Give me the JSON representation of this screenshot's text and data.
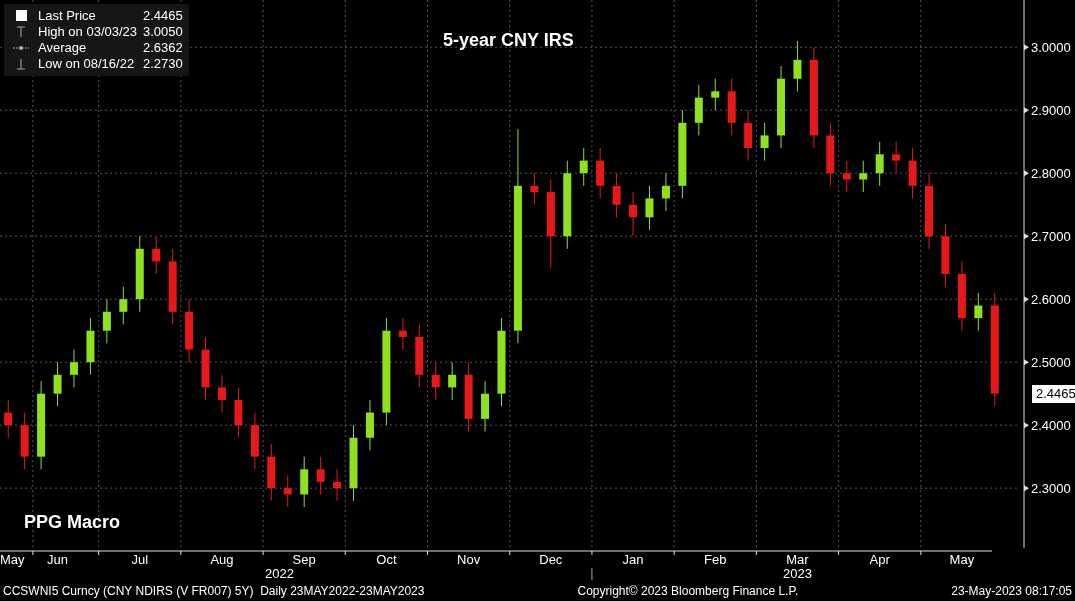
{
  "legend": [
    {
      "kind": "last",
      "label": "Last Price",
      "value": "2.4465"
    },
    {
      "kind": "high",
      "label": "High on 03/03/23",
      "value": "3.0050"
    },
    {
      "kind": "average",
      "label": "Average",
      "value": "2.6362"
    },
    {
      "kind": "low",
      "label": "Low on 08/16/22",
      "value": "2.2730"
    }
  ],
  "title": "5-year CNY IRS",
  "watermark_text": "PPG Macro",
  "last_price_tag": "2.4465",
  "chart_data": {
    "type": "candlestick",
    "grid": true,
    "ylim": [
      2.205,
      3.075
    ],
    "yticks": [
      {
        "value": 2.3,
        "label": "2.3000"
      },
      {
        "value": 2.4,
        "label": "2.4000"
      },
      {
        "value": 2.5,
        "label": "2.5000"
      },
      {
        "value": 2.6,
        "label": "2.6000"
      },
      {
        "value": 2.7,
        "label": "2.7000"
      },
      {
        "value": 2.8,
        "label": "2.8000"
      },
      {
        "value": 2.9,
        "label": "2.9000"
      },
      {
        "value": 3.0,
        "label": "3.0000"
      }
    ],
    "annotations": [
      "2022",
      "2023"
    ],
    "categories": [
      "May",
      null,
      null,
      "Jun",
      null,
      null,
      null,
      null,
      "Jul",
      null,
      null,
      null,
      null,
      "Aug",
      null,
      null,
      null,
      null,
      "Sep",
      null,
      null,
      null,
      null,
      "Oct",
      null,
      null,
      null,
      null,
      "Nov",
      null,
      null,
      null,
      null,
      "Dec",
      null,
      null,
      null,
      null,
      "Jan",
      null,
      null,
      null,
      null,
      "Feb",
      null,
      null,
      null,
      null,
      "Mar",
      null,
      null,
      null,
      null,
      "Apr",
      null,
      null,
      null,
      null,
      "May",
      null,
      null
    ],
    "ohlc": [
      [
        2.42,
        2.44,
        2.38,
        2.4
      ],
      [
        2.4,
        2.42,
        2.33,
        2.35
      ],
      [
        2.35,
        2.47,
        2.33,
        2.45
      ],
      [
        2.45,
        2.5,
        2.43,
        2.48
      ],
      [
        2.48,
        2.52,
        2.46,
        2.5
      ],
      [
        2.5,
        2.57,
        2.48,
        2.55
      ],
      [
        2.55,
        2.6,
        2.53,
        2.58
      ],
      [
        2.58,
        2.62,
        2.56,
        2.6
      ],
      [
        2.6,
        2.7,
        2.58,
        2.68
      ],
      [
        2.68,
        2.7,
        2.64,
        2.66
      ],
      [
        2.66,
        2.68,
        2.56,
        2.58
      ],
      [
        2.58,
        2.6,
        2.5,
        2.52
      ],
      [
        2.52,
        2.54,
        2.44,
        2.46
      ],
      [
        2.46,
        2.48,
        2.42,
        2.44
      ],
      [
        2.44,
        2.46,
        2.38,
        2.4
      ],
      [
        2.4,
        2.42,
        2.33,
        2.35
      ],
      [
        2.35,
        2.37,
        2.28,
        2.3
      ],
      [
        2.3,
        2.32,
        2.27,
        2.29
      ],
      [
        2.29,
        2.35,
        2.27,
        2.33
      ],
      [
        2.33,
        2.35,
        2.29,
        2.31
      ],
      [
        2.31,
        2.33,
        2.28,
        2.3
      ],
      [
        2.3,
        2.4,
        2.28,
        2.38
      ],
      [
        2.38,
        2.44,
        2.36,
        2.42
      ],
      [
        2.42,
        2.57,
        2.4,
        2.55
      ],
      [
        2.55,
        2.57,
        2.52,
        2.54
      ],
      [
        2.54,
        2.56,
        2.46,
        2.48
      ],
      [
        2.48,
        2.5,
        2.44,
        2.46
      ],
      [
        2.46,
        2.5,
        2.44,
        2.48
      ],
      [
        2.48,
        2.5,
        2.39,
        2.41
      ],
      [
        2.41,
        2.47,
        2.39,
        2.45
      ],
      [
        2.45,
        2.57,
        2.43,
        2.55
      ],
      [
        2.55,
        2.87,
        2.53,
        2.78
      ],
      [
        2.78,
        2.8,
        2.75,
        2.77
      ],
      [
        2.77,
        2.79,
        2.65,
        2.7
      ],
      [
        2.7,
        2.82,
        2.68,
        2.8
      ],
      [
        2.8,
        2.84,
        2.78,
        2.82
      ],
      [
        2.82,
        2.84,
        2.76,
        2.78
      ],
      [
        2.78,
        2.8,
        2.73,
        2.75
      ],
      [
        2.75,
        2.77,
        2.7,
        2.73
      ],
      [
        2.73,
        2.78,
        2.71,
        2.76
      ],
      [
        2.76,
        2.8,
        2.74,
        2.78
      ],
      [
        2.78,
        2.9,
        2.76,
        2.88
      ],
      [
        2.88,
        2.94,
        2.86,
        2.92
      ],
      [
        2.92,
        2.95,
        2.9,
        2.93
      ],
      [
        2.93,
        2.95,
        2.86,
        2.88
      ],
      [
        2.88,
        2.9,
        2.82,
        2.84
      ],
      [
        2.84,
        2.88,
        2.82,
        2.86
      ],
      [
        2.86,
        2.97,
        2.84,
        2.95
      ],
      [
        2.95,
        3.01,
        2.93,
        2.98
      ],
      [
        2.98,
        3.0,
        2.84,
        2.86
      ],
      [
        2.86,
        2.88,
        2.78,
        2.8
      ],
      [
        2.8,
        2.82,
        2.77,
        2.79
      ],
      [
        2.79,
        2.82,
        2.77,
        2.8
      ],
      [
        2.8,
        2.85,
        2.78,
        2.83
      ],
      [
        2.83,
        2.85,
        2.8,
        2.82
      ],
      [
        2.82,
        2.84,
        2.76,
        2.78
      ],
      [
        2.78,
        2.8,
        2.68,
        2.7
      ],
      [
        2.7,
        2.72,
        2.62,
        2.64
      ],
      [
        2.64,
        2.66,
        2.55,
        2.57
      ],
      [
        2.57,
        2.61,
        2.55,
        2.59
      ],
      [
        2.59,
        2.61,
        2.43,
        2.45
      ]
    ]
  },
  "footer": {
    "ticker": "CCSWNI5 Curncy (CNY NDIRS (V FR007) 5Y)  Daily 23MAY2022-23MAY2023",
    "copyright": "Copyright© 2023 Bloomberg Finance L.P.",
    "timestamp": "23-May-2023 08:17:05"
  }
}
